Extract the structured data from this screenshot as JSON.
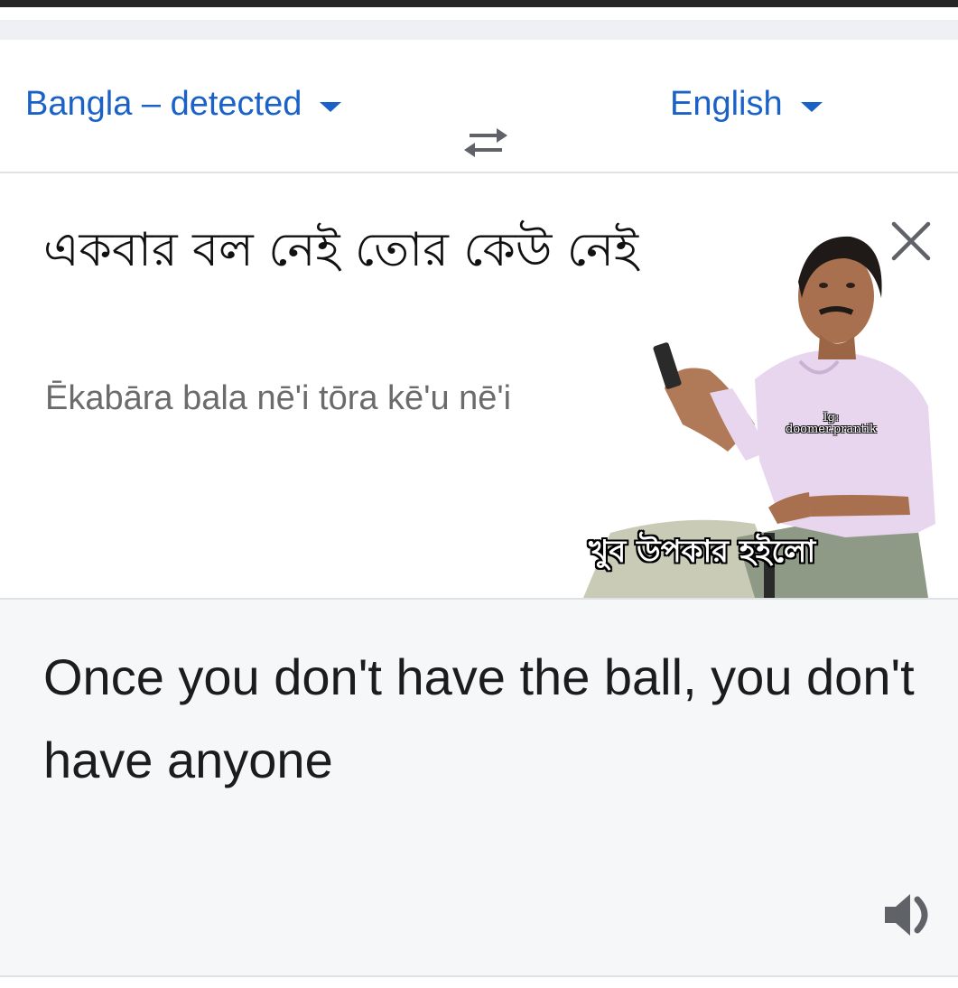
{
  "languages": {
    "source_label": "Bangla – detected",
    "target_label": "English",
    "swap_icon": "swap-arrows-icon"
  },
  "source": {
    "text": "একবার বল নেই তোর কেউ নেই",
    "transliteration": "Ēkabāra bala nē'i tōra kē'u nē'i",
    "clear_icon": "close-icon"
  },
  "meme": {
    "ig_tag_line1": "Ig:",
    "ig_tag_line2": "doomer.prantik",
    "caption": "খুব উপকার হইলো"
  },
  "translation": {
    "text": "Once you don't have the ball, you don't have anyone",
    "speaker_icon": "speaker-icon"
  },
  "colors": {
    "accent": "#1a62c7",
    "divider": "#dfe1e5",
    "target_bg": "#f6f7f9"
  }
}
